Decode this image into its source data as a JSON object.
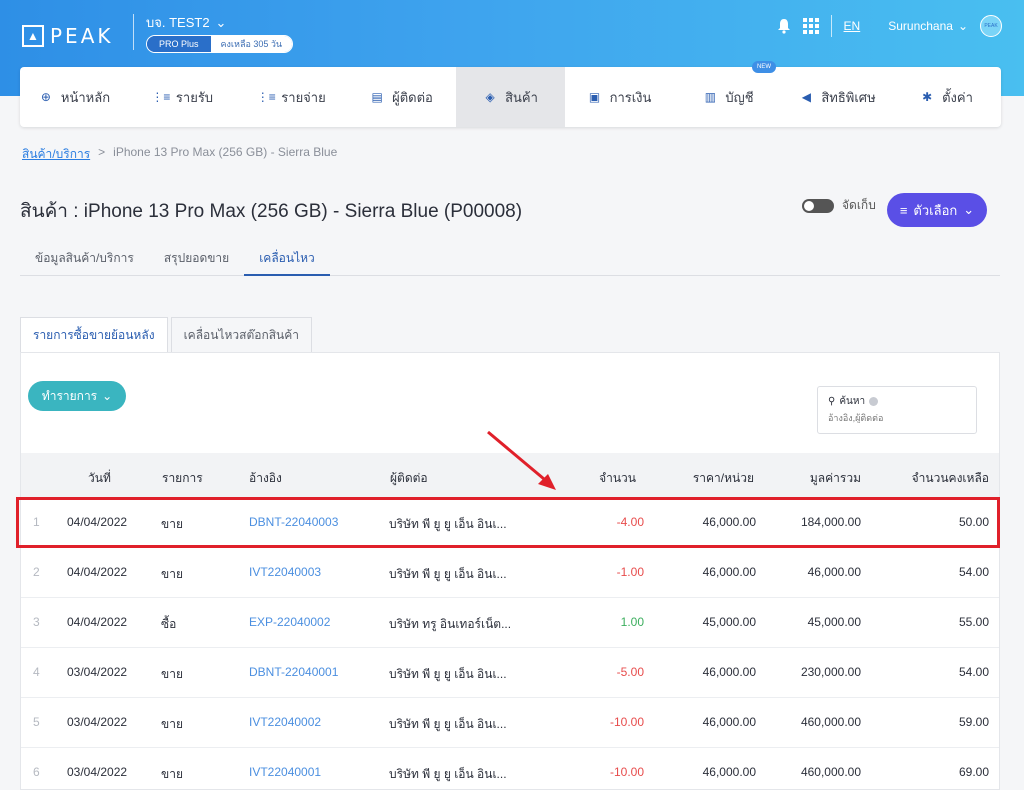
{
  "header": {
    "logo_text": "PEAK",
    "company_name": "บจ. TEST2",
    "plan_badge": "PRO Plus",
    "plan_remaining": "คงเหลือ 305 วัน",
    "language": "EN",
    "username": "Surunchana",
    "avatar_text": "PEAK"
  },
  "nav": {
    "items": [
      {
        "label": "หน้าหลัก",
        "icon": "home-icon"
      },
      {
        "label": "รายรับ",
        "icon": "income-icon"
      },
      {
        "label": "รายจ่าย",
        "icon": "expense-icon"
      },
      {
        "label": "ผู้ติดต่อ",
        "icon": "contacts-icon"
      },
      {
        "label": "สินค้า",
        "icon": "box-icon"
      },
      {
        "label": "การเงิน",
        "icon": "money-icon"
      },
      {
        "label": "บัญชี",
        "icon": "ledger-icon"
      },
      {
        "label": "สิทธิพิเศษ",
        "icon": "megaphone-icon"
      },
      {
        "label": "ตั้งค่า",
        "icon": "gear-icon"
      }
    ],
    "new_badge": "NEW"
  },
  "breadcrumb": {
    "parent": "สินค้า/บริการ",
    "separator": ">",
    "current": "iPhone 13 Pro Max (256 GB) - Sierra Blue"
  },
  "page": {
    "title": "สินค้า : iPhone 13 Pro Max (256 GB) - Sierra Blue (P00008)",
    "archive_label": "จัดเก็บ",
    "options_label": "ตัวเลือก"
  },
  "subtabs": [
    "ข้อมูลสินค้า/บริการ",
    "สรุปยอดขาย",
    "เคลื่อนไหว"
  ],
  "tabs2": [
    "รายการซื้อขายย้อนหลัง",
    "เคลื่อนไหวสต๊อกสินค้า"
  ],
  "toolbar": {
    "action_label": "ทำรายการ",
    "search_label": "ค้นหา",
    "search_placeholder": "อ้างอิง,ผู้ติดต่อ"
  },
  "table": {
    "headers": [
      "วันที่",
      "รายการ",
      "อ้างอิง",
      "ผู้ติดต่อ",
      "จำนวน",
      "ราคา/หน่วย",
      "มูลค่ารวม",
      "จำนวนคงเหลือ"
    ],
    "rows": [
      {
        "idx": "1",
        "date": "04/04/2022",
        "type": "ขาย",
        "ref": "DBNT-22040003",
        "contact": "บริษัท พี ยู ยู เอ็น อินเ...",
        "qty": "-4.00",
        "price": "46,000.00",
        "total": "184,000.00",
        "balance": "50.00"
      },
      {
        "idx": "2",
        "date": "04/04/2022",
        "type": "ขาย",
        "ref": "IVT22040003",
        "contact": "บริษัท พี ยู ยู เอ็น อินเ...",
        "qty": "-1.00",
        "price": "46,000.00",
        "total": "46,000.00",
        "balance": "54.00"
      },
      {
        "idx": "3",
        "date": "04/04/2022",
        "type": "ซื้อ",
        "ref": "EXP-22040002",
        "contact": "บริษัท ทรู อินเทอร์เน็ต...",
        "qty": "1.00",
        "price": "45,000.00",
        "total": "45,000.00",
        "balance": "55.00"
      },
      {
        "idx": "4",
        "date": "03/04/2022",
        "type": "ขาย",
        "ref": "DBNT-22040001",
        "contact": "บริษัท พี ยู ยู เอ็น อินเ...",
        "qty": "-5.00",
        "price": "46,000.00",
        "total": "230,000.00",
        "balance": "54.00"
      },
      {
        "idx": "5",
        "date": "03/04/2022",
        "type": "ขาย",
        "ref": "IVT22040002",
        "contact": "บริษัท พี ยู ยู เอ็น อินเ...",
        "qty": "-10.00",
        "price": "46,000.00",
        "total": "460,000.00",
        "balance": "59.00"
      },
      {
        "idx": "6",
        "date": "03/04/2022",
        "type": "ขาย",
        "ref": "IVT22040001",
        "contact": "บริษัท พี ยู ยู เอ็น อินเ...",
        "qty": "-10.00",
        "price": "46,000.00",
        "total": "460,000.00",
        "balance": "69.00"
      }
    ]
  },
  "colors": {
    "accent": "#5a4fe6",
    "teal": "#3ab5c0",
    "link": "#4b8fe0",
    "negative": "#e74c4c",
    "positive": "#3cae5e",
    "highlight": "#e0202a"
  }
}
